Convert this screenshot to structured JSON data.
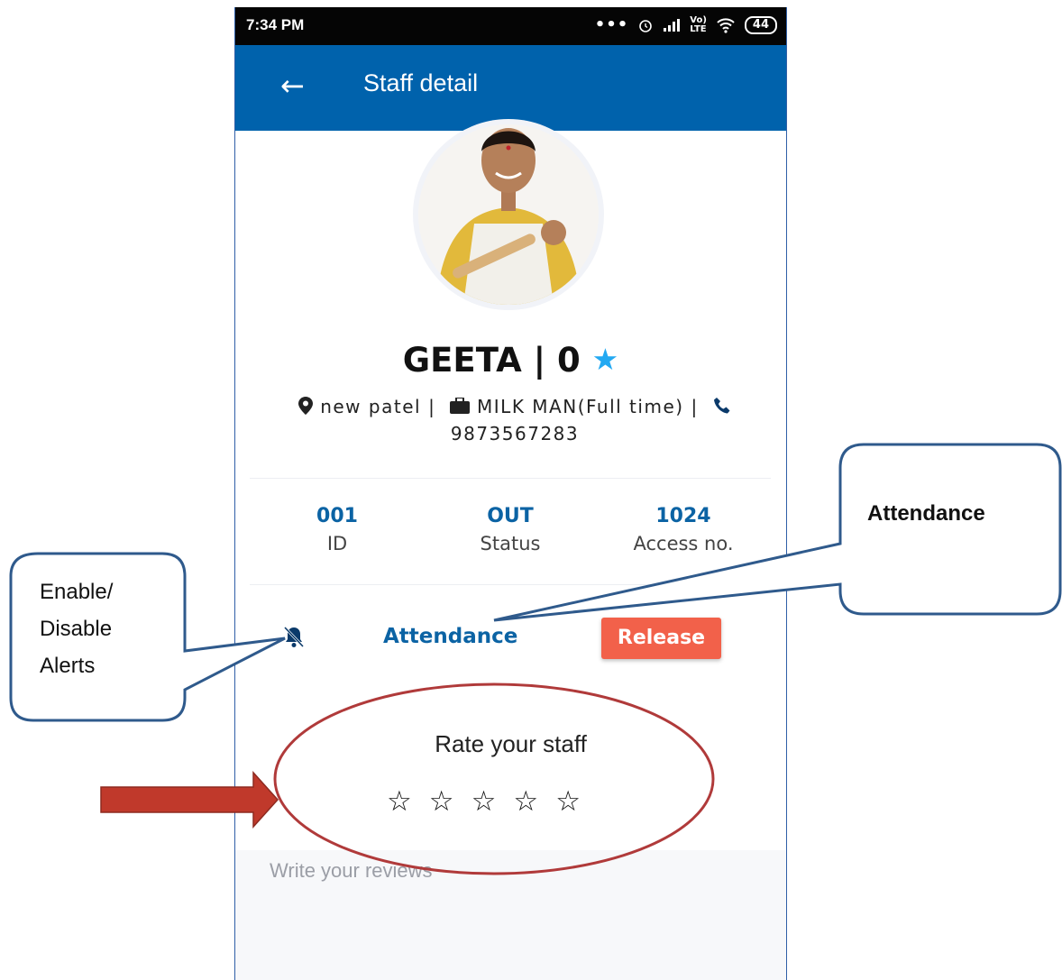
{
  "status_bar": {
    "time": "7:34 PM",
    "battery": "44"
  },
  "app_bar": {
    "back_icon": "back-arrow-icon",
    "title": "Staff detail"
  },
  "staff": {
    "name_row": "GEETA | 0",
    "location": "new patel",
    "job": "MILK MAN(Full time)",
    "phone": "9873567283"
  },
  "stats": [
    {
      "value": "001",
      "label": "ID"
    },
    {
      "value": "OUT",
      "label": "Status"
    },
    {
      "value": "1024",
      "label": "Access no."
    }
  ],
  "actions": {
    "alert_icon": "bell-off-icon",
    "attendance_label": "Attendance",
    "release_label": "Release"
  },
  "rating": {
    "title": "Rate your staff",
    "stars_total": 5,
    "stars_selected": 0
  },
  "review": {
    "placeholder": "Write your reviews"
  },
  "annotations": {
    "alerts_callout": "Enable/\nDisable\nAlerts",
    "attendance_callout": "Attendance"
  },
  "colors": {
    "app_bar": "#0062ac",
    "accent_blue": "#0b63a4",
    "release": "#f2614a",
    "callout_border": "#2f5a8c",
    "ellipse": "#b03a3a",
    "arrow": "#c0392b"
  }
}
